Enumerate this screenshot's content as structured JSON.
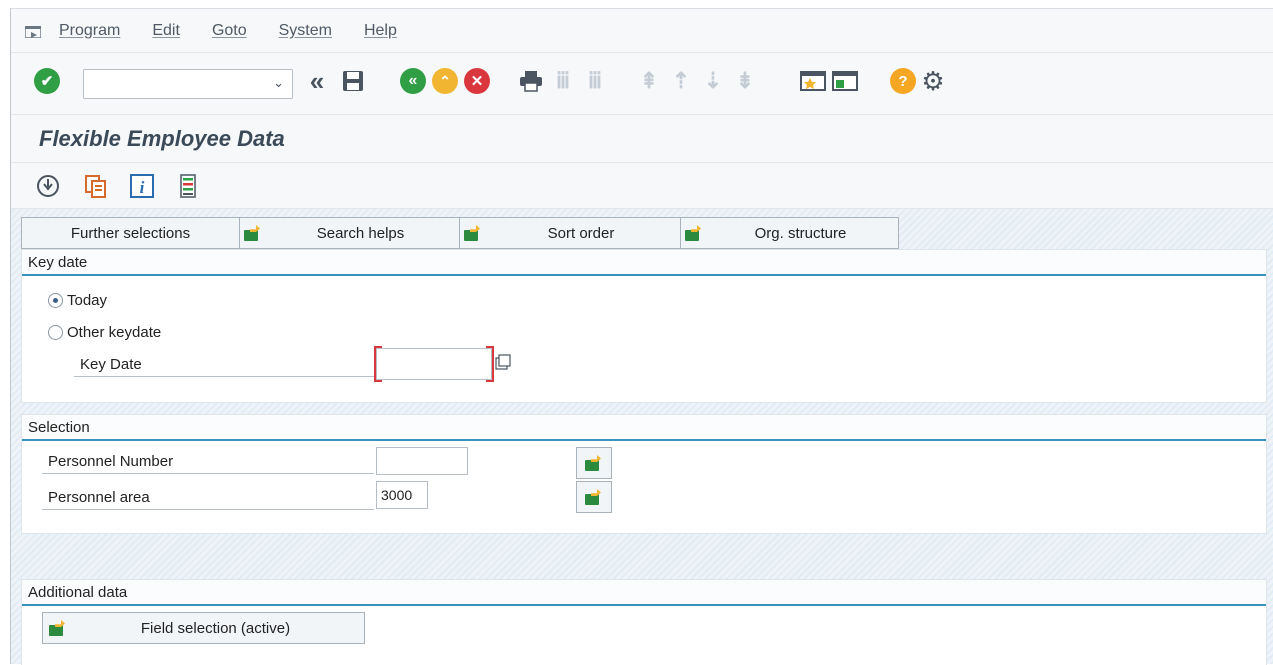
{
  "menu": {
    "items": [
      "Program",
      "Edit",
      "Goto",
      "System",
      "Help"
    ]
  },
  "toolbar": {
    "command_field_value": "",
    "icons": [
      "enter-icon",
      "command-dropdown-icon",
      "back-double-icon",
      "save-icon",
      "back-icon",
      "exit-icon",
      "cancel-icon",
      "print-icon",
      "find-icon",
      "find-next-icon",
      "first-page-icon",
      "previous-page-icon",
      "next-page-icon",
      "last-page-icon",
      "create-session-icon",
      "shortcut-icon",
      "help-icon",
      "settings-icon"
    ]
  },
  "page": {
    "title": "Flexible Employee Data"
  },
  "app_toolbar": {
    "icons": [
      "execute-icon",
      "get-variant-icon",
      "info-icon",
      "selection-options-icon"
    ]
  },
  "tabs": {
    "further_selections": "Further selections",
    "search_helps": "Search helps",
    "sort_order": "Sort order",
    "org_structure": "Org. structure"
  },
  "key_date": {
    "heading": "Key date",
    "option_today": "Today",
    "option_other": "Other keydate",
    "selected": "Today",
    "key_date_label": "Key Date",
    "key_date_value": ""
  },
  "selection": {
    "heading": "Selection",
    "personnel_number_label": "Personnel Number",
    "personnel_number_value": "",
    "personnel_area_label": "Personnel area",
    "personnel_area_value": "3000"
  },
  "additional": {
    "heading": "Additional data",
    "field_selection_label": "Field selection (active)"
  },
  "colors": {
    "accent_blue": "#3a92bf",
    "enter_green": "#2f9e44",
    "exit_orange": "#f2b531",
    "cancel_red": "#d9363e",
    "help_orange": "#f5a623"
  }
}
